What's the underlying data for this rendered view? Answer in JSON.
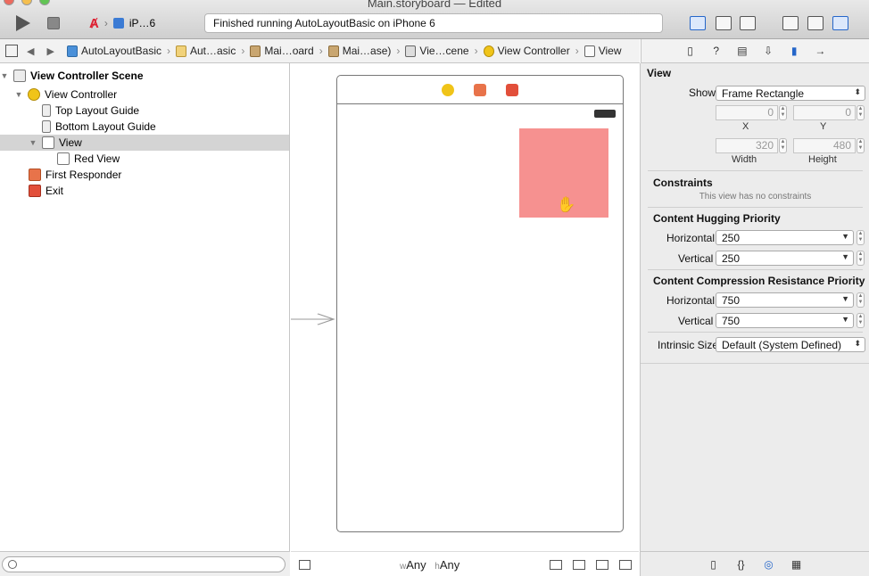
{
  "window": {
    "title": "Main.storyboard — Edited"
  },
  "toolbar": {
    "scheme_label": "iP…6",
    "status_message": "Finished running AutoLayoutBasic on iPhone 6"
  },
  "jumpbar": {
    "items": [
      "AutoLayoutBasic",
      "Aut…asic",
      "Mai…oard",
      "Mai…ase)",
      "Vie…cene",
      "View Controller",
      "View"
    ]
  },
  "outline": {
    "rows": [
      {
        "label": "View Controller Scene",
        "icon": "scene-icon"
      },
      {
        "label": "View Controller",
        "icon": "view-controller-icon"
      },
      {
        "label": "Top Layout Guide",
        "icon": "layout-guide-icon"
      },
      {
        "label": "Bottom Layout Guide",
        "icon": "layout-guide-icon"
      },
      {
        "label": "View",
        "icon": "view-icon",
        "selected": true
      },
      {
        "label": "Red View",
        "icon": "view-icon"
      },
      {
        "label": "First Responder",
        "icon": "first-responder-icon"
      },
      {
        "label": "Exit",
        "icon": "exit-icon"
      }
    ]
  },
  "canvas": {
    "size_class_w_prefix": "w",
    "size_class_w": "Any",
    "size_class_h_prefix": "h",
    "size_class_h": "Any",
    "red_view_color": "#f69190"
  },
  "inspector": {
    "section_title": "View",
    "show_label": "Show",
    "show_value": "Frame Rectangle",
    "x_value": "0",
    "y_value": "0",
    "x_label": "X",
    "y_label": "Y",
    "width_value": "320",
    "height_value": "480",
    "width_label": "Width",
    "height_label": "Height",
    "constraints_title": "Constraints",
    "constraints_note": "This view has no constraints",
    "hugging_title": "Content Hugging Priority",
    "hugging_h_label": "Horizontal",
    "hugging_h_value": "250",
    "hugging_v_label": "Vertical",
    "hugging_v_value": "250",
    "compression_title": "Content Compression Resistance Priority",
    "compression_h_label": "Horizontal",
    "compression_h_value": "750",
    "compression_v_label": "Vertical",
    "compression_v_value": "750",
    "intrinsic_label": "Intrinsic Size",
    "intrinsic_value": "Default (System Defined)"
  },
  "colors": {
    "accent": "#2566c9",
    "red_view": "#f69190"
  }
}
